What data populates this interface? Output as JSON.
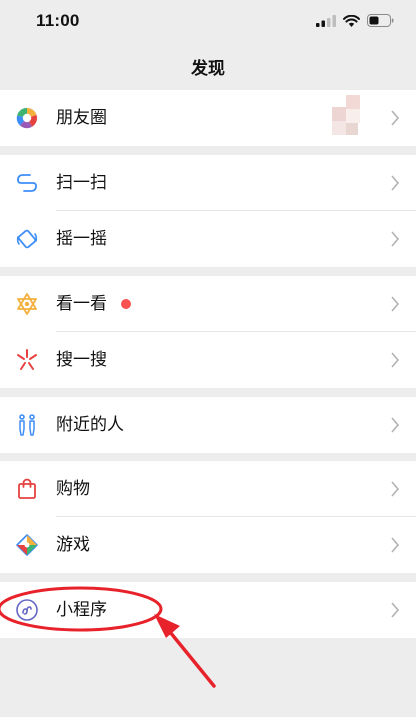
{
  "status_bar": {
    "time": "11:00"
  },
  "nav": {
    "title": "发现"
  },
  "groups": [
    {
      "items": [
        {
          "label": "朋友圈",
          "icon": "moments-icon"
        }
      ]
    },
    {
      "items": [
        {
          "label": "扫一扫",
          "icon": "scan-icon"
        },
        {
          "label": "摇一摇",
          "icon": "shake-icon"
        }
      ]
    },
    {
      "items": [
        {
          "label": "看一看",
          "icon": "top-stories-icon",
          "badge": "red-dot"
        },
        {
          "label": "搜一搜",
          "icon": "search-icon"
        }
      ]
    },
    {
      "items": [
        {
          "label": "附近的人",
          "icon": "people-nearby-icon"
        }
      ]
    },
    {
      "items": [
        {
          "label": "购物",
          "icon": "shopping-bag-icon"
        },
        {
          "label": "游戏",
          "icon": "games-icon"
        }
      ]
    },
    {
      "items": [
        {
          "label": "小程序",
          "icon": "mini-programs-icon"
        }
      ]
    }
  ],
  "colors": {
    "background": "#ededed",
    "badge": "#fa5151",
    "annotation": "#e8222a"
  }
}
